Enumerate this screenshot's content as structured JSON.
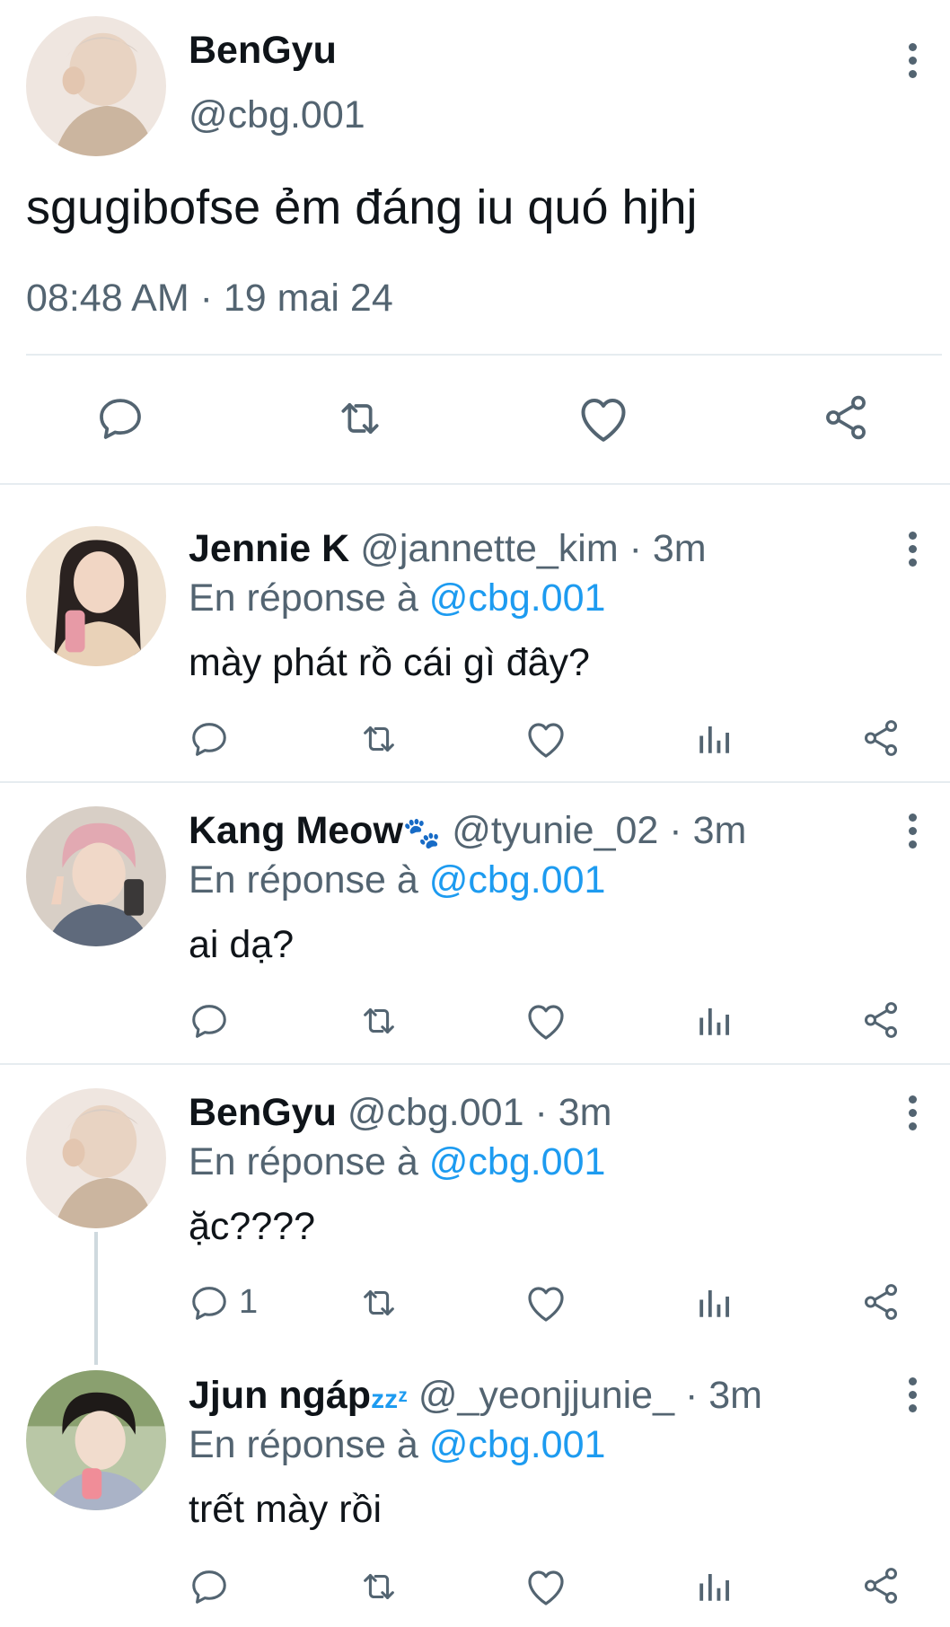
{
  "main_tweet": {
    "display_name": "BenGyu",
    "handle": "@cbg.001",
    "text": "sgugibofse ẻm đáng iu quó hjhj",
    "timestamp": "08:48 AM · 19 mai 24"
  },
  "replies": [
    {
      "display_name": "Jennie K",
      "handle": "@jannette_kim",
      "time": "· 3m",
      "reply_prefix": "En réponse à",
      "reply_to": "@cbg.001",
      "text": "mày phát rồ cái gì đây?"
    },
    {
      "display_name": "Kang Meow",
      "name_emoji": "🐾",
      "handle": "@tyunie_02",
      "time": "· 3m",
      "reply_prefix": "En réponse à",
      "reply_to": "@cbg.001",
      "text": "ai dạ?"
    },
    {
      "display_name": "BenGyu",
      "handle": "@cbg.001",
      "time": "· 3m",
      "reply_prefix": "En réponse à",
      "reply_to": "@cbg.001",
      "text": "ặc????",
      "reply_count": "1"
    },
    {
      "display_name": "Jjun ngáp",
      "name_suffix": "zzᶻ",
      "handle": "@_yeonjjunie_",
      "time": "· 3m",
      "reply_prefix": "En réponse à",
      "reply_to": "@cbg.001",
      "text": "trết mày rồi"
    }
  ],
  "colors": {
    "text": "#0f1419",
    "secondary": "#536471",
    "link": "#1d9bf0",
    "divider": "#e6ecf0"
  },
  "icons": [
    "reply-icon",
    "retweet-icon",
    "like-icon",
    "views-icon",
    "share-icon",
    "more-icon"
  ]
}
